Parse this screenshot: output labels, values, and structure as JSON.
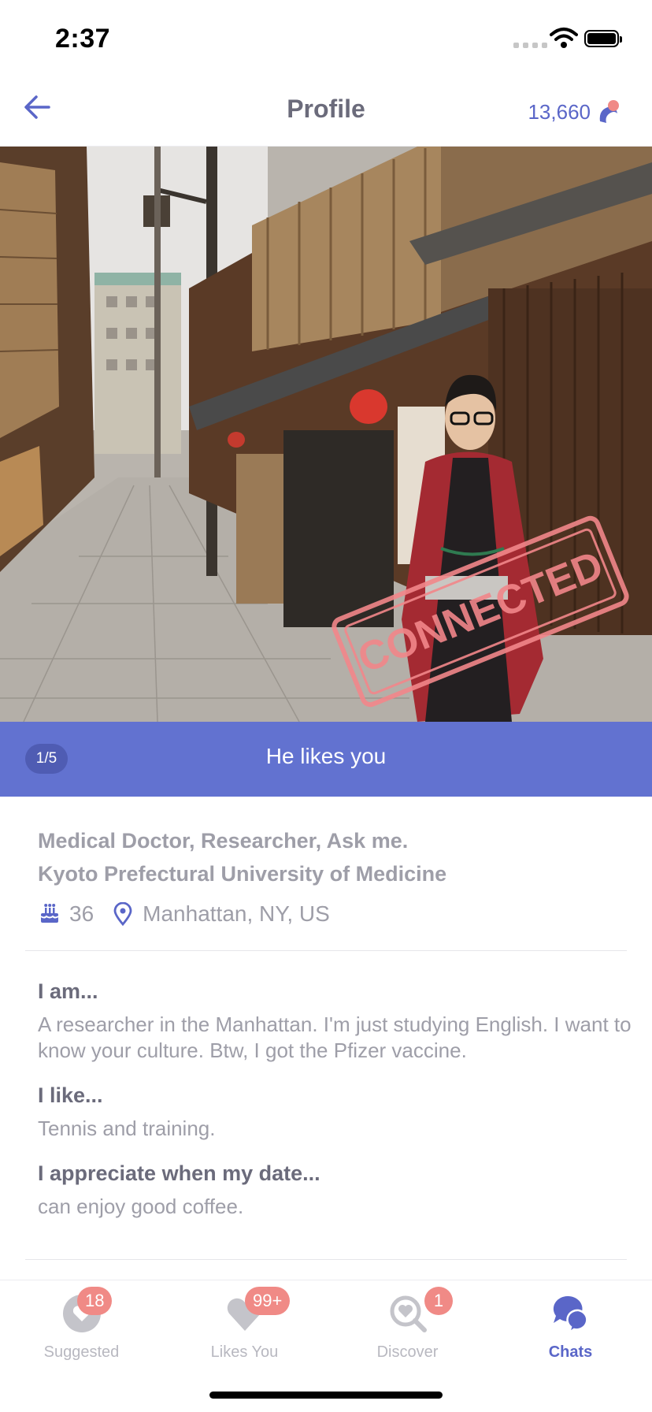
{
  "status_bar": {
    "time": "2:37"
  },
  "header": {
    "title": "Profile",
    "coins": "13,660"
  },
  "photo": {
    "stamp": "CONNECTED",
    "counter": "1/5",
    "banner": "He likes you"
  },
  "profile": {
    "occupation": "Medical Doctor, Researcher, Ask me.",
    "school": "Kyoto Prefectural University of Medicine",
    "age": "36",
    "location": "Manhattan, NY, US"
  },
  "prompts": [
    {
      "q": "I am...",
      "a": "A researcher in the Manhattan. I'm just studying English. I want to know your culture. Btw, I got the Pfizer vaccine."
    },
    {
      "q": "I like...",
      "a": "Tennis and training."
    },
    {
      "q": "I appreciate when my date...",
      "a": "can enjoy good coffee."
    }
  ],
  "tabs": [
    {
      "label": "Suggested",
      "badge": "18",
      "icon": "heart-icon"
    },
    {
      "label": "Likes You",
      "badge": "99+",
      "icon": "heart-filled-icon"
    },
    {
      "label": "Discover",
      "badge": "1",
      "icon": "search-heart-icon"
    },
    {
      "label": "Chats",
      "badge": "",
      "icon": "chat-bubbles-icon"
    }
  ],
  "colors": {
    "accent": "#5a66c8",
    "badge": "#f08a86",
    "stamp": "#f2868a",
    "banner": "#5a6ace"
  }
}
